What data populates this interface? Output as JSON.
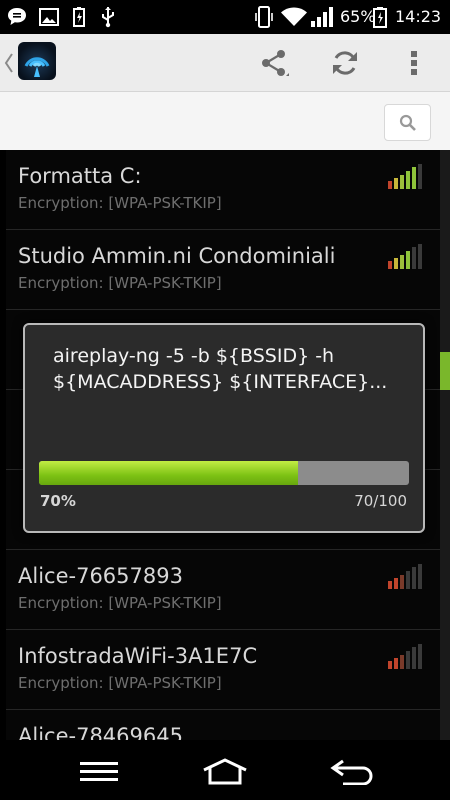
{
  "status_bar": {
    "battery_percent": "65%",
    "time": "14:23",
    "icons": [
      "chat-bubble-icon",
      "image-icon",
      "battery-charging-icon",
      "usb-icon",
      "phone-vibrate-icon",
      "wifi-icon",
      "cell-signal-icon",
      "battery-icon"
    ]
  },
  "action_bar": {
    "icons": [
      "back-chevron-icon",
      "app-logo-icon",
      "share-icon",
      "refresh-icon",
      "overflow-menu-icon"
    ]
  },
  "search": {
    "icon": "search-icon"
  },
  "networks": [
    {
      "name": "Formatta C:",
      "encryption": "Encryption: [WPA-PSK-TKIP]"
    },
    {
      "name": "Studio Ammin.ni Condominiali",
      "encryption": "Encryption: [WPA-PSK-TKIP]"
    },
    {
      "name": "",
      "encryption": ""
    },
    {
      "name": "",
      "encryption": ""
    },
    {
      "name": "",
      "encryption": ""
    },
    {
      "name": "Alice-76657893",
      "encryption": "Encryption: [WPA-PSK-TKIP]"
    },
    {
      "name": "InfostradaWiFi-3A1E7C",
      "encryption": "Encryption: [WPA-PSK-TKIP]"
    },
    {
      "name": "Alice-78469645",
      "encryption": ""
    }
  ],
  "dialog": {
    "message": "aireplay-ng -5 -b ${BSSID} -h ${MACADDRESS} ${INTERFACE}...",
    "progress_fraction": 0.7,
    "progress_percent": "70%",
    "progress_count": "70/100"
  },
  "colors": {
    "progress_fill": "#7dc214",
    "progress_track": "#8c8c8c",
    "signal_strong": "#8fc43a",
    "signal_medium": "#c7b63a",
    "signal_weak": "#c0442c"
  },
  "nav_bar": {
    "icons": [
      "menu-icon",
      "home-icon",
      "back-icon"
    ]
  }
}
